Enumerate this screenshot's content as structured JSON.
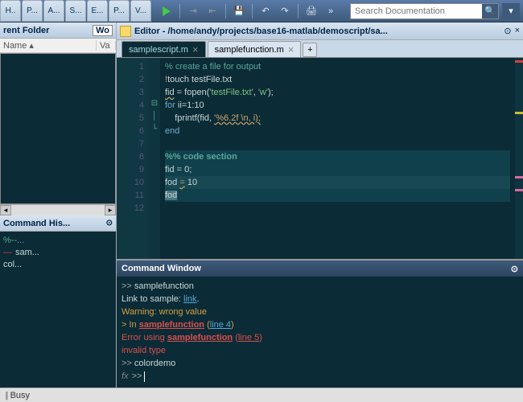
{
  "toolbar": {
    "tabs": [
      "H..",
      "P...",
      "A...",
      "S...",
      "E...",
      "P...",
      "V..."
    ],
    "search_placeholder": "Search Documentation"
  },
  "left": {
    "folder_title": "rent Folder",
    "folder_tab": "Wo",
    "col_name": "Name",
    "col_value": "Va",
    "history_title": "Command His...",
    "history": [
      {
        "mark": "",
        "text": "%--...",
        "class": "c-comment"
      },
      {
        "mark": "—",
        "text": "sam...",
        "class": "c-var"
      },
      {
        "mark": "",
        "text": "col...",
        "class": "c-var"
      }
    ]
  },
  "editor": {
    "title": "Editor - /home/andy/projects/base16-matlab/demoscript/sa...",
    "tabs": [
      {
        "label": "samplescript.m",
        "active": true
      },
      {
        "label": "samplefunction.m",
        "active": false
      }
    ],
    "lines": [
      {
        "n": 1,
        "fold": "",
        "html": "<span class='c-comment'>% create a file for output</span>"
      },
      {
        "n": 2,
        "fold": "",
        "html": "<span class='c-shell'>!</span><span class='c-var'>touch testFile.txt</span>"
      },
      {
        "n": 3,
        "fold": "",
        "html": "<span class='c-var c-underline'>fid</span><span class='c-var'> = fopen(</span><span class='c-string'>'testFile.txt'</span><span class='c-var'>, </span><span class='c-string'>'w'</span><span class='c-var'>);</span>"
      },
      {
        "n": 4,
        "fold": "⊟",
        "html": "<span class='c-keyword'>for</span><span class='c-var'> ii=1:10</span>"
      },
      {
        "n": 5,
        "fold": "│",
        "html": "    <span class='c-var'>fprintf(fid, </span><span class='c-error'>'%6.2f \\n, i);</span>"
      },
      {
        "n": 6,
        "fold": "└",
        "html": "<span class='c-keyword'>end</span>"
      },
      {
        "n": 7,
        "fold": "",
        "html": ""
      },
      {
        "n": 8,
        "fold": "",
        "section": true,
        "html": "<span class='c-comment' style='font-weight:bold'>%% code section</span>"
      },
      {
        "n": 9,
        "fold": "",
        "section": true,
        "html": "<span class='c-var'>fid = 0;</span>"
      },
      {
        "n": 10,
        "fold": "",
        "section": true,
        "hl": true,
        "html": "<span class='c-var'>fod </span><span class='c-error'>=</span><span class='c-var'> 10</span>"
      },
      {
        "n": 11,
        "fold": "",
        "section": true,
        "html": "<span class='c-selected'>fod</span>"
      },
      {
        "n": 12,
        "fold": "",
        "html": ""
      }
    ],
    "markers": [
      "red",
      "",
      "",
      "",
      "yellow",
      "",
      "",
      "",
      "",
      "pink",
      "pink",
      ""
    ]
  },
  "cmd": {
    "title": "Command Window",
    "lines": [
      {
        "html": "<span class='cmd-prompt'>>> </span><span class='cmd-text'>samplefunction</span>"
      },
      {
        "html": "<span class='cmd-text'>Link to sample: </span><span class='cmd-link'>link</span><span class='cmd-text'>.</span>"
      },
      {
        "html": "<span class='cmd-warn'>Warning: wrong value</span>"
      },
      {
        "html": "<span class='cmd-warn'>> In </span><span class='cmd-err'><a>samplefunction</a></span><span class='cmd-warn'> (</span><span class='cmd-link'>line 4</span><span class='cmd-warn'>)</span>"
      },
      {
        "html": "<span class='cmd-err'>Error using <a>samplefunction</a> (<span style='text-decoration:underline'>line 5</span>)</span>"
      },
      {
        "html": "<span class='cmd-err'>invalid type</span>"
      },
      {
        "html": "<span class='cmd-prompt'>>> </span><span class='cmd-text'>colordemo</span>"
      }
    ]
  },
  "status": "Busy"
}
